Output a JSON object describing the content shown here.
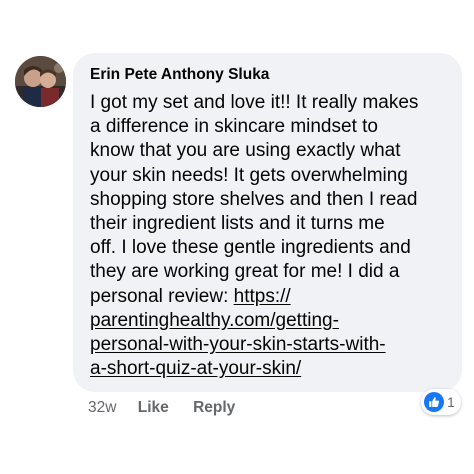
{
  "comment": {
    "author": "Erin Pete Anthony Sluka",
    "text_lines": [
      "I got my set and love it!! It really makes",
      "a difference in skincare mindset to",
      "know that you are using exactly what",
      "your skin needs! It gets overwhelming",
      "shopping store shelves and then I read",
      "their ingredient lists and it turns me",
      "off. I love these gentle ingredients and",
      "they are working great for me! I did a"
    ],
    "text_prefix_before_link": "personal review: ",
    "link_lines": [
      "https://",
      "parentinghealthy.com/getting-",
      "personal-with-your-skin-starts-with-",
      "a-short-quiz-at-your-skin/"
    ]
  },
  "actions": {
    "timestamp": "32w",
    "like_label": "Like",
    "reply_label": "Reply"
  },
  "reactions": {
    "icon": "like-reaction-icon",
    "count": "1",
    "like_color": "#1877f2"
  },
  "colors": {
    "bubble_background": "#f0f2f5",
    "secondary_text": "#65676b"
  }
}
